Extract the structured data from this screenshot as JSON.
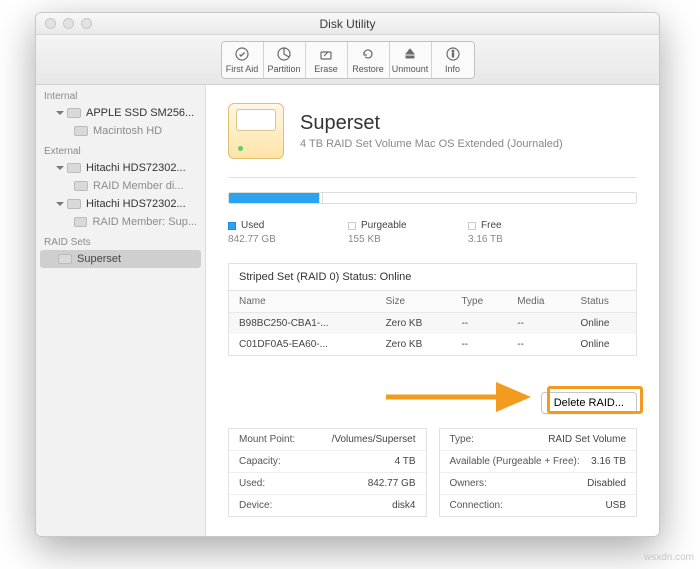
{
  "window": {
    "title": "Disk Utility"
  },
  "toolbar": [
    {
      "name": "first-aid-button",
      "label": "First Aid"
    },
    {
      "name": "partition-button",
      "label": "Partition"
    },
    {
      "name": "erase-button",
      "label": "Erase"
    },
    {
      "name": "restore-button",
      "label": "Restore"
    },
    {
      "name": "unmount-button",
      "label": "Unmount"
    },
    {
      "name": "info-button",
      "label": "Info"
    }
  ],
  "sidebar": {
    "sections": {
      "internal": "Internal",
      "external": "External",
      "raid": "RAID Sets"
    },
    "internal_disk": "APPLE SSD SM256...",
    "internal_vol": "Macintosh HD",
    "ext1": "Hitachi HDS72302...",
    "ext1_child": "RAID Member di...",
    "ext2": "Hitachi HDS72302...",
    "ext2_child": "RAID Member: Sup...",
    "raid_item": "Superset"
  },
  "hero": {
    "name": "Superset",
    "sub": "4 TB RAID Set Volume Mac OS Extended (Journaled)"
  },
  "usage": {
    "used_label": "Used",
    "used_val": "842.77 GB",
    "purge_label": "Purgeable",
    "purge_val": "155 KB",
    "free_label": "Free",
    "free_val": "3.16 TB"
  },
  "raid_panel": {
    "header": "Striped Set (RAID 0) Status: Online",
    "cols": {
      "name": "Name",
      "size": "Size",
      "type": "Type",
      "media": "Media",
      "status": "Status"
    },
    "rows": [
      {
        "name": "B98BC250-CBA1-...",
        "size": "Zero KB",
        "type": "--",
        "media": "--",
        "status": "Online"
      },
      {
        "name": "C01DF0A5-EA60-...",
        "size": "Zero KB",
        "type": "--",
        "media": "--",
        "status": "Online"
      }
    ],
    "delete_btn": "Delete RAID..."
  },
  "info_left": [
    {
      "k": "Mount Point:",
      "v": "/Volumes/Superset"
    },
    {
      "k": "Capacity:",
      "v": "4 TB"
    },
    {
      "k": "Used:",
      "v": "842.77 GB"
    },
    {
      "k": "Device:",
      "v": "disk4"
    }
  ],
  "info_right": [
    {
      "k": "Type:",
      "v": "RAID Set Volume"
    },
    {
      "k": "Available (Purgeable + Free):",
      "v": "3.16 TB"
    },
    {
      "k": "Owners:",
      "v": "Disabled"
    },
    {
      "k": "Connection:",
      "v": "USB"
    }
  ],
  "watermark": "wsxdn.com"
}
